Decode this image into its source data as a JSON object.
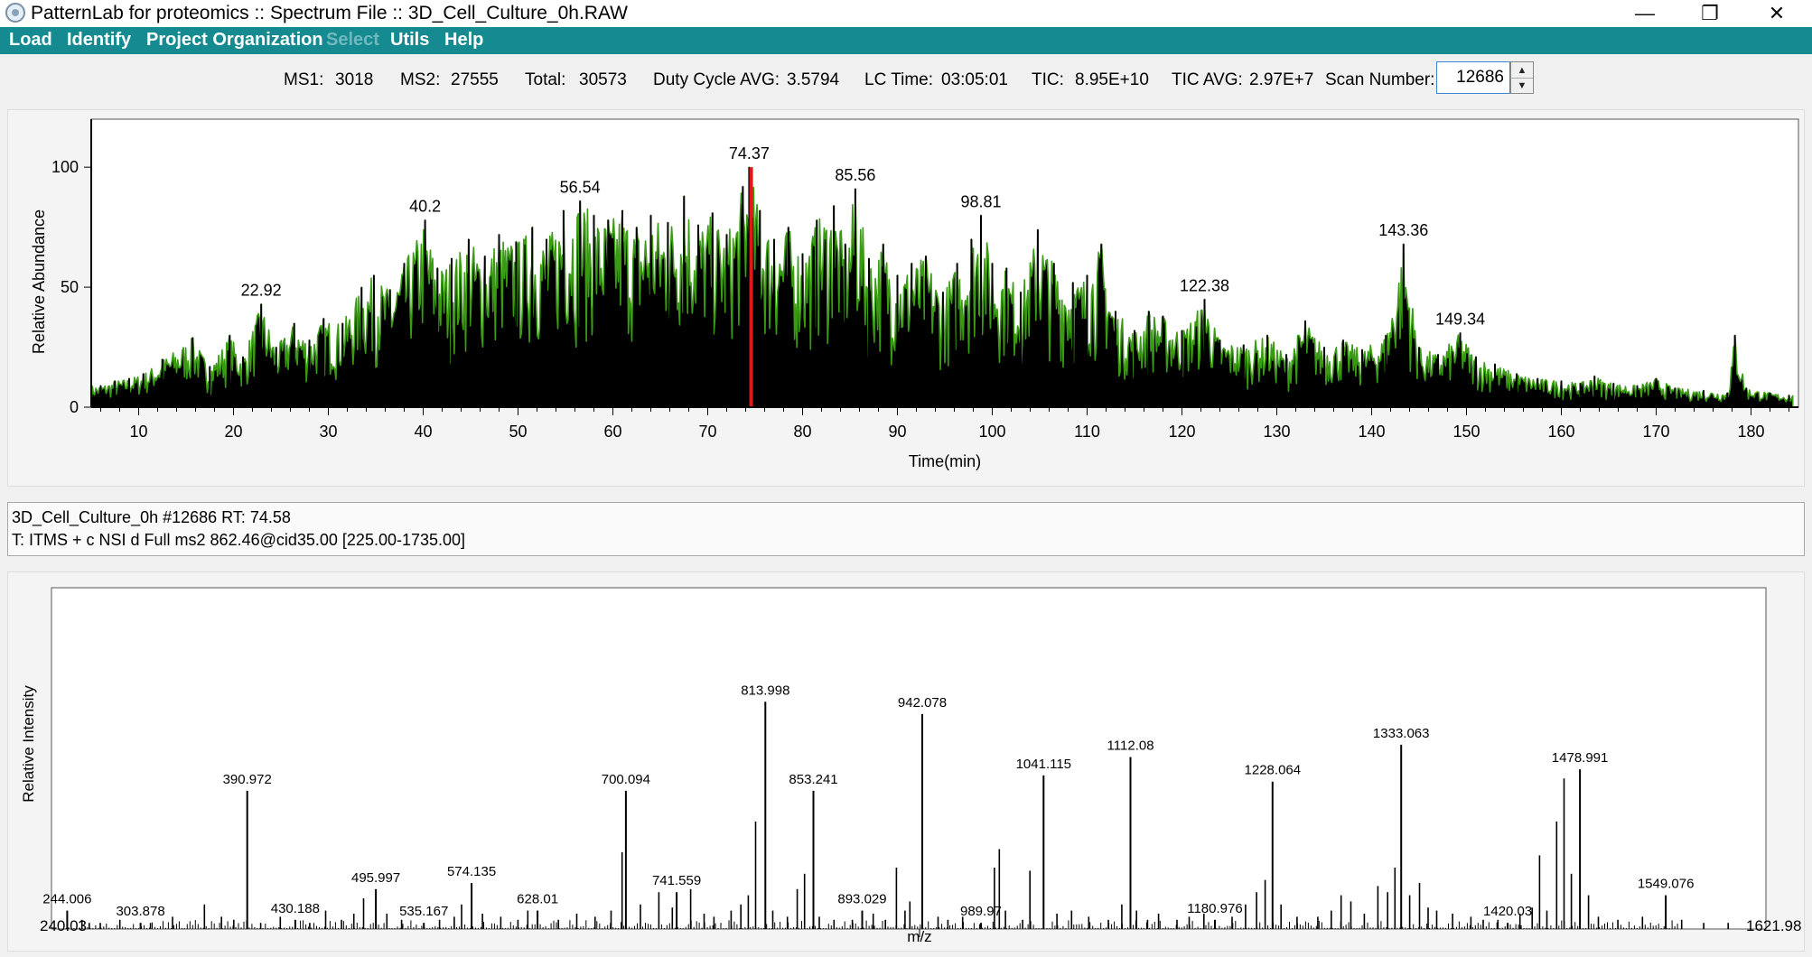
{
  "window": {
    "title": "PatternLab for proteomics :: Spectrum File :: 3D_Cell_Culture_0h.RAW",
    "minimize_glyph": "—",
    "restore_glyph": "❐",
    "close_glyph": "✕"
  },
  "menu": {
    "items": [
      {
        "label": "Load",
        "enabled": true
      },
      {
        "label": "Identify",
        "enabled": true
      },
      {
        "label": "Project Organization",
        "enabled": true
      },
      {
        "label": "Select",
        "enabled": false
      },
      {
        "label": "Utils",
        "enabled": true
      },
      {
        "label": "Help",
        "enabled": true
      }
    ]
  },
  "stats": {
    "ms1_label": "MS1:",
    "ms1": "3018",
    "ms2_label": "MS2:",
    "ms2": "27555",
    "total_label": "Total:",
    "total": "30573",
    "duty_label": "Duty Cycle AVG:",
    "duty": "3.5794",
    "lc_label": "LC Time:",
    "lc": "03:05:01",
    "tic_label": "TIC:",
    "tic": "8.95E+10",
    "ticavg_label": "TIC AVG:",
    "ticavg": "2.97E+7",
    "scan_label": "Scan Number:",
    "scan_value": "12686"
  },
  "scan_info": {
    "line1": "3D_Cell_Culture_0h #12686 RT: 74.58",
    "line2": "T: ITMS + c NSI d Full ms2 862.46@cid35.00 [225.00-1735.00]"
  },
  "chart_data": [
    {
      "type": "area",
      "name": "chromatogram",
      "xlabel": "Time(min)",
      "ylabel": "Relative Abundance",
      "xlim": [
        5,
        185
      ],
      "ylim": [
        0,
        120
      ],
      "xticks": [
        "10",
        "20",
        "30",
        "40",
        "50",
        "60",
        "70",
        "80",
        "90",
        "100",
        "110",
        "120",
        "130",
        "140",
        "150",
        "160",
        "170",
        "180"
      ],
      "yticks": [
        "0",
        "50",
        "100"
      ],
      "fill_color": "#000000",
      "edge_color": "#3a9a14",
      "marker_color": "#e01818",
      "selected_rt": 74.58,
      "peak_labels": [
        {
          "x": 22.92,
          "y": 43,
          "label": "22.92"
        },
        {
          "x": 40.2,
          "y": 78,
          "label": "40.2"
        },
        {
          "x": 56.54,
          "y": 86,
          "label": "56.54"
        },
        {
          "x": 74.37,
          "y": 100,
          "label": "74.37"
        },
        {
          "x": 85.56,
          "y": 91,
          "label": "85.56"
        },
        {
          "x": 98.81,
          "y": 80,
          "label": "98.81"
        },
        {
          "x": 122.38,
          "y": 45,
          "label": "122.38"
        },
        {
          "x": 143.36,
          "y": 68,
          "label": "143.36"
        },
        {
          "x": 149.34,
          "y": 31,
          "label": "149.34"
        }
      ],
      "peaks": [
        [
          6,
          9
        ],
        [
          7.5,
          11
        ],
        [
          9,
          12
        ],
        [
          10.5,
          14
        ],
        [
          12.5,
          20
        ],
        [
          15.7,
          29
        ],
        [
          17.5,
          17
        ],
        [
          19.6,
          30
        ],
        [
          21,
          21
        ],
        [
          22.92,
          43
        ],
        [
          24.5,
          25
        ],
        [
          26.4,
          35
        ],
        [
          28,
          28
        ],
        [
          29.5,
          37
        ],
        [
          31.5,
          35
        ],
        [
          33.5,
          50
        ],
        [
          34.8,
          55
        ],
        [
          36.5,
          49
        ],
        [
          38,
          60
        ],
        [
          40.2,
          78
        ],
        [
          41.5,
          58
        ],
        [
          43,
          62
        ],
        [
          44.8,
          70
        ],
        [
          46.5,
          63
        ],
        [
          48,
          72
        ],
        [
          49.8,
          69
        ],
        [
          51.5,
          75
        ],
        [
          53,
          70
        ],
        [
          54.8,
          82
        ],
        [
          56.54,
          86
        ],
        [
          58,
          80
        ],
        [
          59.5,
          78
        ],
        [
          61,
          82
        ],
        [
          62.5,
          75
        ],
        [
          64,
          80
        ],
        [
          65.8,
          77
        ],
        [
          67.5,
          88
        ],
        [
          69,
          76
        ],
        [
          70.5,
          81
        ],
        [
          72,
          72
        ],
        [
          73.7,
          92
        ],
        [
          74.37,
          100
        ],
        [
          75.5,
          82
        ],
        [
          77,
          70
        ],
        [
          78.5,
          75
        ],
        [
          80,
          64
        ],
        [
          81.5,
          78
        ],
        [
          83.3,
          84
        ],
        [
          84.5,
          68
        ],
        [
          85.56,
          91
        ],
        [
          87,
          62
        ],
        [
          88.5,
          68
        ],
        [
          90,
          55
        ],
        [
          91.5,
          60
        ],
        [
          93,
          63
        ],
        [
          94.8,
          48
        ],
        [
          96.3,
          60
        ],
        [
          97.8,
          70
        ],
        [
          98.81,
          80
        ],
        [
          100,
          60
        ],
        [
          101.5,
          58
        ],
        [
          103,
          48
        ],
        [
          104.8,
          74
        ],
        [
          106.5,
          60
        ],
        [
          108.5,
          52
        ],
        [
          110,
          55
        ],
        [
          111.5,
          68
        ],
        [
          113,
          40
        ],
        [
          115,
          32
        ],
        [
          116.5,
          40
        ],
        [
          118,
          38
        ],
        [
          120,
          32
        ],
        [
          122.38,
          45
        ],
        [
          124,
          28
        ],
        [
          126.5,
          26
        ],
        [
          129,
          30
        ],
        [
          131,
          22
        ],
        [
          133,
          36
        ],
        [
          135,
          25
        ],
        [
          137,
          28
        ],
        [
          139,
          24
        ],
        [
          141.5,
          30
        ],
        [
          143.36,
          68
        ],
        [
          145,
          25
        ],
        [
          147,
          22
        ],
        [
          149.34,
          31
        ],
        [
          151,
          21
        ],
        [
          153,
          18
        ],
        [
          155.3,
          14
        ],
        [
          157.5,
          12
        ],
        [
          160,
          11
        ],
        [
          162,
          10
        ],
        [
          163.5,
          13
        ],
        [
          165.5,
          10
        ],
        [
          168,
          9
        ],
        [
          170,
          12
        ],
        [
          172,
          8
        ],
        [
          175,
          7
        ],
        [
          177.5,
          6
        ],
        [
          178.3,
          30
        ],
        [
          179.5,
          8
        ],
        [
          182,
          6
        ],
        [
          184,
          5
        ]
      ]
    },
    {
      "type": "bar",
      "name": "ms2-spectrum",
      "xlabel": "m/z",
      "ylabel": "Relative Intensity",
      "xlim": [
        240.03,
        1621.98
      ],
      "xlim_labels": [
        "240.03",
        "1621.98"
      ],
      "ylim": [
        0,
        100
      ],
      "bar_color": "#000000",
      "labeled_peaks": [
        {
          "x": 244.006,
          "y": 6,
          "label": "244.006"
        },
        {
          "x": 303.878,
          "y": 2,
          "label": "303.878"
        },
        {
          "x": 390.972,
          "y": 45,
          "label": "390.972"
        },
        {
          "x": 430.188,
          "y": 3,
          "label": "430.188"
        },
        {
          "x": 495.997,
          "y": 13,
          "label": "495.997"
        },
        {
          "x": 535.167,
          "y": 2,
          "label": "535.167"
        },
        {
          "x": 574.135,
          "y": 15,
          "label": "574.135"
        },
        {
          "x": 628.01,
          "y": 6,
          "label": "628.01"
        },
        {
          "x": 700.094,
          "y": 45,
          "label": "700.094"
        },
        {
          "x": 741.559,
          "y": 12,
          "label": "741.559"
        },
        {
          "x": 813.998,
          "y": 74,
          "label": "813.998"
        },
        {
          "x": 853.241,
          "y": 45,
          "label": "853.241"
        },
        {
          "x": 893.029,
          "y": 6,
          "label": "893.029"
        },
        {
          "x": 942.078,
          "y": 70,
          "label": "942.078"
        },
        {
          "x": 989.97,
          "y": 2,
          "label": "989.97"
        },
        {
          "x": 1041.115,
          "y": 50,
          "label": "1041.115"
        },
        {
          "x": 1112.08,
          "y": 56,
          "label": "1112.08"
        },
        {
          "x": 1180.976,
          "y": 3,
          "label": "1180.976"
        },
        {
          "x": 1228.064,
          "y": 48,
          "label": "1228.064"
        },
        {
          "x": 1333.063,
          "y": 60,
          "label": "1333.063"
        },
        {
          "x": 1420.03,
          "y": 2,
          "label": "1420.03"
        },
        {
          "x": 1478.991,
          "y": 52,
          "label": "1478.991"
        },
        {
          "x": 1549.076,
          "y": 11,
          "label": "1549.076"
        }
      ],
      "other_peaks": [
        [
          256,
          3
        ],
        [
          262,
          2
        ],
        [
          271,
          2
        ],
        [
          287,
          3
        ],
        [
          312,
          2
        ],
        [
          330,
          4
        ],
        [
          356,
          8
        ],
        [
          370,
          4
        ],
        [
          380,
          3
        ],
        [
          402,
          2
        ],
        [
          418,
          4
        ],
        [
          442,
          2
        ],
        [
          455,
          6
        ],
        [
          468,
          3
        ],
        [
          478,
          5
        ],
        [
          486,
          10
        ],
        [
          505,
          5
        ],
        [
          517,
          3
        ],
        [
          548,
          3
        ],
        [
          560,
          4
        ],
        [
          566,
          8
        ],
        [
          583,
          5
        ],
        [
          598,
          4
        ],
        [
          612,
          3
        ],
        [
          620,
          6
        ],
        [
          645,
          3
        ],
        [
          660,
          5
        ],
        [
          675,
          4
        ],
        [
          688,
          6
        ],
        [
          697,
          25
        ],
        [
          712,
          8
        ],
        [
          727,
          12
        ],
        [
          738,
          7
        ],
        [
          753,
          13
        ],
        [
          764,
          5
        ],
        [
          772,
          4
        ],
        [
          786,
          6
        ],
        [
          794,
          8
        ],
        [
          800,
          11
        ],
        [
          806,
          35
        ],
        [
          820,
          6
        ],
        [
          832,
          4
        ],
        [
          840,
          13
        ],
        [
          846,
          18
        ],
        [
          858,
          4
        ],
        [
          870,
          3
        ],
        [
          885,
          3
        ],
        [
          902,
          5
        ],
        [
          912,
          3
        ],
        [
          921,
          20
        ],
        [
          928,
          6
        ],
        [
          932,
          9
        ],
        [
          955,
          4
        ],
        [
          963,
          3
        ],
        [
          975,
          4
        ],
        [
          1001,
          20
        ],
        [
          1005,
          26
        ],
        [
          1010,
          6
        ],
        [
          1024,
          3
        ],
        [
          1030,
          19
        ],
        [
          1052,
          5
        ],
        [
          1064,
          6
        ],
        [
          1078,
          4
        ],
        [
          1094,
          3
        ],
        [
          1105,
          8
        ],
        [
          1117,
          6
        ],
        [
          1126,
          3
        ],
        [
          1135,
          5
        ],
        [
          1150,
          3
        ],
        [
          1160,
          4
        ],
        [
          1172,
          5
        ],
        [
          1195,
          4
        ],
        [
          1206,
          8
        ],
        [
          1215,
          12
        ],
        [
          1222,
          16
        ],
        [
          1235,
          8
        ],
        [
          1248,
          4
        ],
        [
          1265,
          4
        ],
        [
          1276,
          6
        ],
        [
          1284,
          11
        ],
        [
          1292,
          9
        ],
        [
          1303,
          5
        ],
        [
          1314,
          14
        ],
        [
          1322,
          12
        ],
        [
          1328,
          20
        ],
        [
          1340,
          11
        ],
        [
          1348,
          15
        ],
        [
          1355,
          7
        ],
        [
          1362,
          6
        ],
        [
          1375,
          5
        ],
        [
          1390,
          4
        ],
        [
          1400,
          3
        ],
        [
          1412,
          3
        ],
        [
          1430,
          5
        ],
        [
          1440,
          7
        ],
        [
          1446,
          24
        ],
        [
          1452,
          6
        ],
        [
          1460,
          35
        ],
        [
          1466,
          49
        ],
        [
          1472,
          18
        ],
        [
          1486,
          11
        ],
        [
          1494,
          4
        ],
        [
          1510,
          3
        ],
        [
          1530,
          4
        ],
        [
          1562,
          3
        ],
        [
          1580,
          2
        ],
        [
          1600,
          2
        ]
      ]
    }
  ]
}
